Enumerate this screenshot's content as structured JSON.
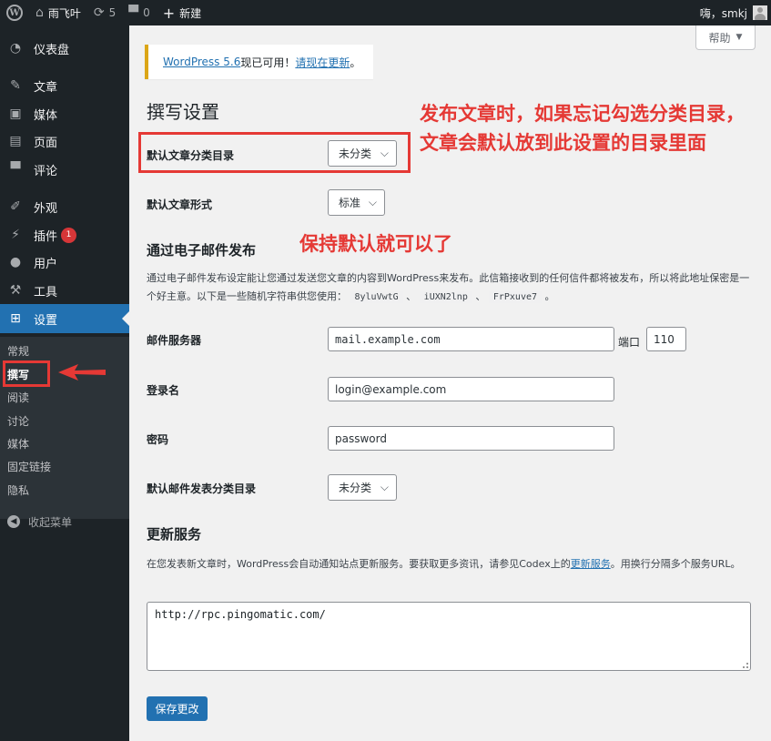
{
  "adminbar": {
    "wp_logo_glyph": "W",
    "site_name": "雨飞叶",
    "updates_count": "5",
    "comments_count": "0",
    "new_label": "新建",
    "greeting": "嗨，smkj"
  },
  "sidebar": {
    "items": [
      {
        "label": "仪表盘",
        "icon": "dashboard-icon"
      },
      {
        "label": "文章",
        "icon": "pin-icon"
      },
      {
        "label": "媒体",
        "icon": "media-icon"
      },
      {
        "label": "页面",
        "icon": "page-icon"
      },
      {
        "label": "评论",
        "icon": "comment-icon"
      },
      {
        "label": "外观",
        "icon": "brush-icon"
      },
      {
        "label": "插件",
        "icon": "plugin-icon",
        "badge": "1"
      },
      {
        "label": "用户",
        "icon": "user-icon"
      },
      {
        "label": "工具",
        "icon": "wrench-icon"
      },
      {
        "label": "设置",
        "icon": "settings-icon",
        "active": true
      }
    ],
    "submenu": [
      "常规",
      "撰写",
      "阅读",
      "讨论",
      "媒体",
      "固定链接",
      "隐私"
    ],
    "collapse_label": "收起菜单"
  },
  "main": {
    "help_label": "帮助",
    "notice": {
      "link_version": "WordPress 5.6",
      "text_mid": "现已可用！",
      "link_update": "请现在更新",
      "text_end": "。"
    },
    "page_title": "撰写设置",
    "default_category": {
      "label": "默认文章分类目录",
      "value": "未分类"
    },
    "default_format": {
      "label": "默认文章形式",
      "value": "标准"
    },
    "email_section": {
      "title": "通过电子邮件发布",
      "desc_prefix": "通过电子邮件发布设定能让您通过发送您文章的内容到WordPress来发布。此信箱接收到的任何信件都将被发布，所以将此地址保密是一个好主意。以下是一些随机字符串供您使用：",
      "codes": [
        "8yluVwtG",
        "iUXN2lnp",
        "FrPxuve7"
      ],
      "sep": "、",
      "desc_end": "。"
    },
    "mail_server": {
      "label": "邮件服务器",
      "placeholder": "mail.example.com",
      "port_label": "端口",
      "port_value": "110"
    },
    "login": {
      "label": "登录名",
      "placeholder": "login@example.com"
    },
    "password": {
      "label": "密码",
      "placeholder": "password"
    },
    "mail_category": {
      "label": "默认邮件发表分类目录",
      "value": "未分类"
    },
    "update_services": {
      "title": "更新服务",
      "desc_prefix": "在您发表新文章时，WordPress会自动通知站点更新服务。要获取更多资讯，请参见Codex上的",
      "desc_link": "更新服务",
      "desc_suffix": "。用换行分隔多个服务URL。",
      "textarea_value": "http://rpc.pingomatic.com/"
    },
    "save_label": "保存更改"
  },
  "annotations": {
    "category_note": "发布文章时，如果忘记勾选分类目录，文章会默认放到此设置的目录里面",
    "email_note": "保持默认就可以了",
    "color": "#e53935"
  }
}
